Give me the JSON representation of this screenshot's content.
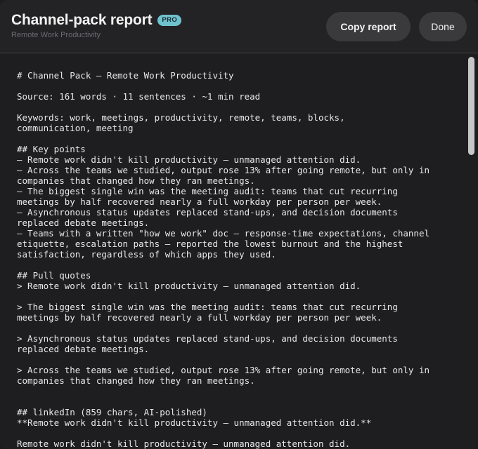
{
  "header": {
    "title": "Channel-pack report",
    "badge": "PRO",
    "subtitle": "Remote Work Productivity",
    "copy_label": "Copy report",
    "done_label": "Done"
  },
  "report": {
    "text": "# Channel Pack — Remote Work Productivity\n\nSource: 161 words · 11 sentences · ~1 min read\n\nKeywords: work, meetings, productivity, remote, teams, blocks,\ncommunication, meeting\n\n## Key points\n– Remote work didn't kill productivity — unmanaged attention did.\n– Across the teams we studied, output rose 13% after going remote, but only in\ncompanies that changed how they ran meetings.\n– The biggest single win was the meeting audit: teams that cut recurring\nmeetings by half recovered nearly a full workday per person per week.\n– Asynchronous status updates replaced stand-ups, and decision documents\nreplaced debate meetings.\n– Teams with a written \"how we work\" doc — response-time expectations, channel\netiquette, escalation paths — reported the lowest burnout and the highest\nsatisfaction, regardless of which apps they used.\n\n## Pull quotes\n> Remote work didn't kill productivity — unmanaged attention did.\n\n> The biggest single win was the meeting audit: teams that cut recurring\nmeetings by half recovered nearly a full workday per person per week.\n\n> Asynchronous status updates replaced stand-ups, and decision documents\nreplaced debate meetings.\n\n> Across the teams we studied, output rose 13% after going remote, but only in\ncompanies that changed how they ran meetings.\n\n\n## linkedIn (859 chars, AI-polished)\n**Remote work didn't kill productivity — unmanaged attention did.**\n\nRemote work didn't kill productivity — unmanaged attention did."
  }
}
